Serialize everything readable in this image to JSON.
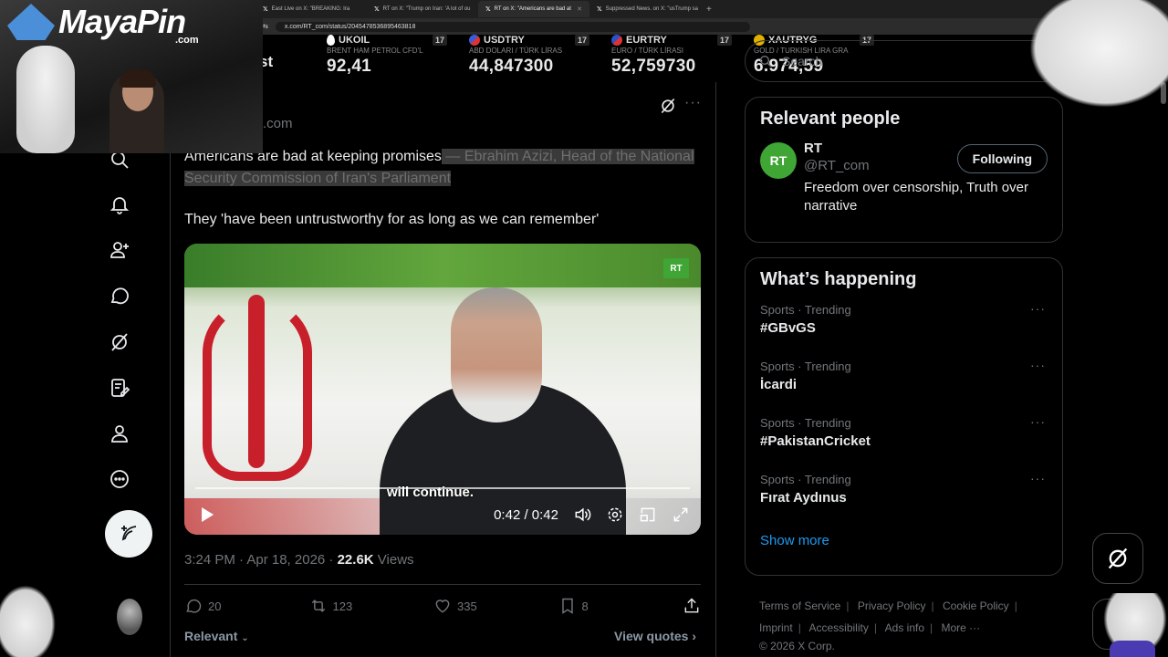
{
  "browser": {
    "tabs": [
      {
        "label": "East Live on X: \"BREAKING: Ira",
        "active": false
      },
      {
        "label": "RT on X: \"Trump on Iran: 'A lot of ou",
        "active": false
      },
      {
        "label": "RT on X: \"Americans are bad at",
        "active": true
      },
      {
        "label": "Suppressed News. on X: \"usTrump sa",
        "active": false
      }
    ],
    "url": "x.com/RT_com/status/2045478536895463818"
  },
  "ticker": [
    {
      "symbol": "UKOIL",
      "desc": "BRENT HAM PETROL CFD'L",
      "value": "92,41",
      "flag_color": "#ffffff"
    },
    {
      "symbol": "USDTRY",
      "desc": "ABD DOLARI / TÜRK LİRAS",
      "value": "44,847300",
      "flag_color": "#3b5bdb"
    },
    {
      "symbol": "EURTRY",
      "desc": "EURO / TÜRK LİRASI",
      "value": "52,759730",
      "flag_color": "#2b50c8"
    },
    {
      "symbol": "XAUTRYG",
      "desc": "GOLD / TURKISH LIRA GRA",
      "value": "6.974,59",
      "flag_color": "#e1b000"
    }
  ],
  "overlay": {
    "logo_text": "MayaPin",
    "logo_sub": ".com"
  },
  "main": {
    "title_partial": "st",
    "handle_partial": ".com",
    "tweet_text": "Americans are bad at keeping promises",
    "tweet_highlight": " — Ebrahim Azizi, Head of the National Security Commission of Iran's Parliament ",
    "tweet_line2": "They 'have been untrustworthy for as long as we can remember'",
    "video": {
      "subtitle": "will continue.",
      "time": "0:42 / 0:42",
      "badge": "RT"
    },
    "timestamp": "3:24 PM · Apr 18, 2026 · ",
    "views_count": "22.6K",
    "views_label": " Views",
    "actions": {
      "replies": "20",
      "reposts": "123",
      "likes": "335",
      "bookmarks": "8"
    },
    "relevant_label": "Relevant",
    "view_quotes": "View quotes"
  },
  "sidebar": {
    "search_placeholder": "Search",
    "relevant_title": "Relevant people",
    "person": {
      "name": "RT",
      "handle": "@RT_com",
      "bio": "Freedom over censorship, Truth over narrative",
      "follow_label": "Following",
      "avatar_text": "RT"
    },
    "happening_title": "What’s happening",
    "trends": [
      {
        "meta": "Sports · Trending",
        "name": "#GBvGS"
      },
      {
        "meta": "Sports · Trending",
        "name": "İcardi"
      },
      {
        "meta": "Sports · Trending",
        "name": "#PakistanCricket"
      },
      {
        "meta": "Sports · Trending",
        "name": "Fırat Aydınus"
      }
    ],
    "show_more": "Show more",
    "footer": {
      "terms": "Terms of Service",
      "privacy": "Privacy Policy",
      "cookie": "Cookie Policy",
      "imprint": "Imprint",
      "accessibility": "Accessibility",
      "ads": "Ads info",
      "more": "More ···",
      "copyright": "© 2026 X Corp."
    }
  },
  "colors": {
    "accent": "#1d9bf0",
    "rt_green": "#3fa534",
    "text": "#e7e9ea",
    "muted": "#71767b"
  }
}
